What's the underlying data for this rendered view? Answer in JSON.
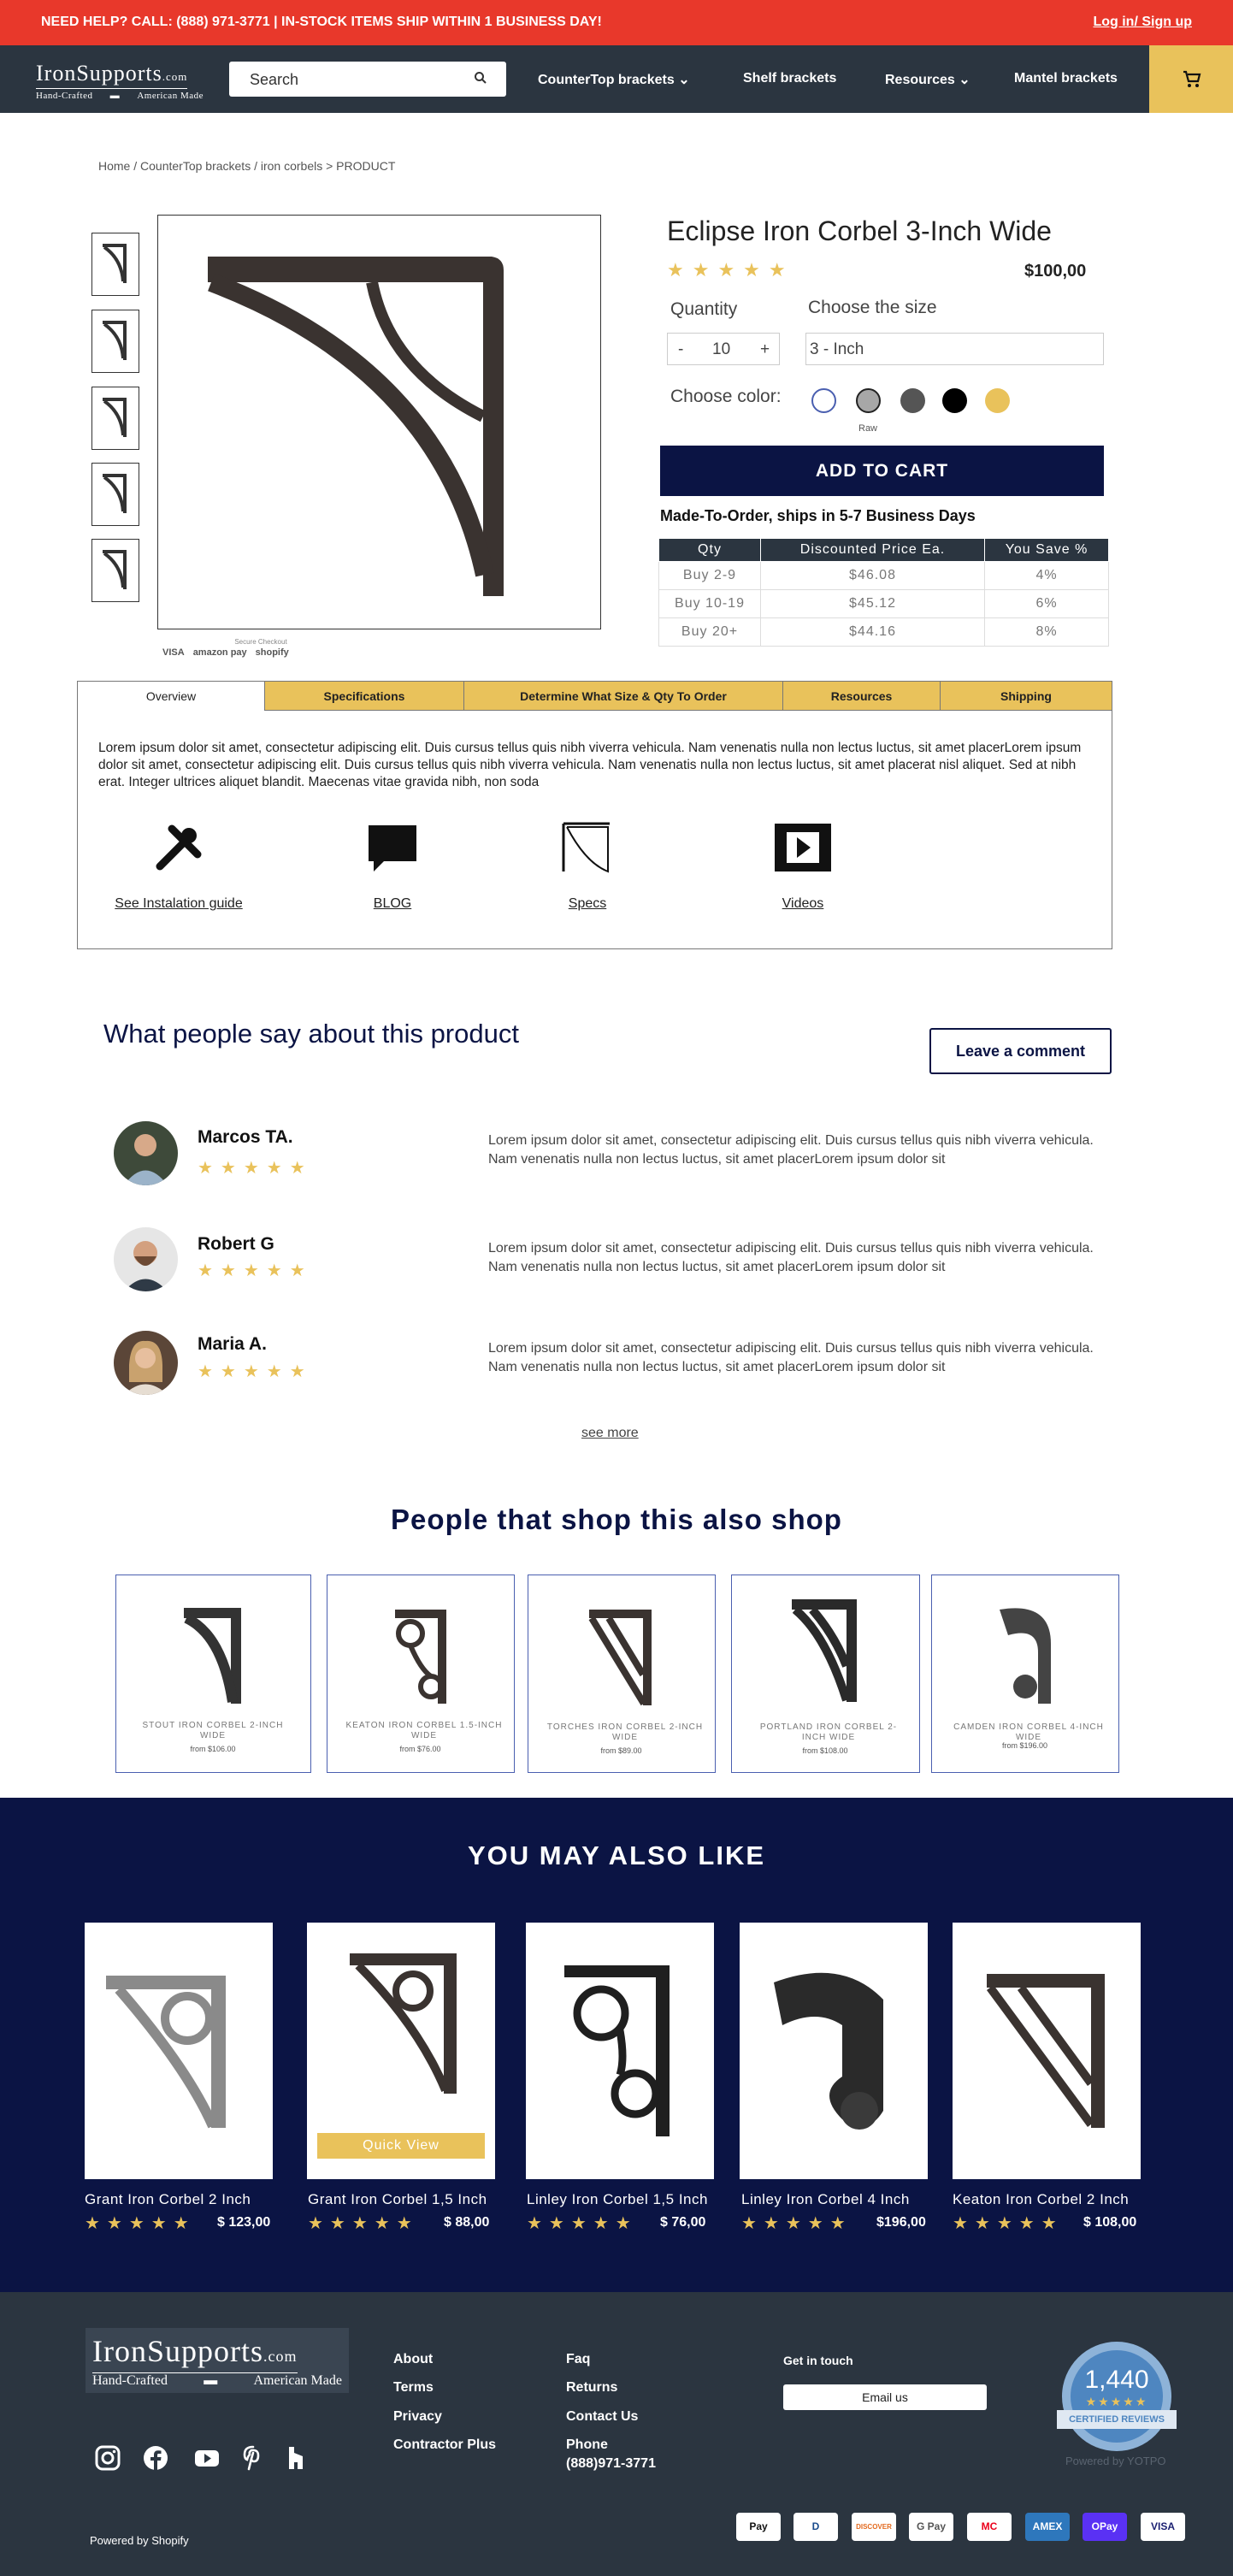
{
  "topbar": {
    "message": "NEED HELP? CALL: (888) 971-3771 | IN-STOCK ITEMS SHIP WITHIN 1 BUSINESS DAY!",
    "login": "Log in/ Sign up"
  },
  "header": {
    "logo_main": "IronSupports",
    "logo_suffix": ".com",
    "logo_left": "Hand-Crafted",
    "logo_right": "American Made",
    "search_placeholder": "Search",
    "nav": [
      "CounterTop brackets",
      "Shelf brackets",
      "Resources",
      "Mantel brackets"
    ]
  },
  "breadcrumb": "Home  /  CounterTop brackets  / iron corbels > PRODUCT",
  "product": {
    "title": "Eclipse Iron Corbel 3-Inch Wide",
    "stars": "★★★★★",
    "price": "$100,00",
    "quantity_label": "Quantity",
    "quantity_minus": "-",
    "quantity_value": "10",
    "quantity_plus": "+",
    "size_label": "Choose the size",
    "size_value": "3 - Inch",
    "color_label": "Choose color:",
    "color_selected_caption": "Raw",
    "colors": [
      "#ffffff",
      "#a7a7a7",
      "#555555",
      "#000000",
      "#e9c25b"
    ],
    "add_to_cart": "ADD TO CART",
    "made_to_order": "Made-To-Order, ships in 5-7 Business Days",
    "checkout_caption": "Secure Checkout",
    "checkout_logos": [
      "VISA",
      "amazon pay",
      "shopify"
    ]
  },
  "discount_table": {
    "headers": [
      "Qty",
      "Discounted Price Ea.",
      "You Save %"
    ],
    "rows": [
      [
        "Buy 2-9",
        "$46.08",
        "4%"
      ],
      [
        "Buy 10-19",
        "$45.12",
        "6%"
      ],
      [
        "Buy 20+",
        "$44.16",
        "8%"
      ]
    ]
  },
  "tabs": {
    "items": [
      "Overview",
      "Specifications",
      "Determine What Size & Qty To Order",
      "Resources",
      "Shipping"
    ],
    "overview_text": "Lorem ipsum dolor sit amet, consectetur adipiscing elit. Duis cursus tellus quis nibh viverra vehicula. Nam venenatis nulla non lectus luctus, sit amet placerLorem ipsum dolor sit amet, consectetur adipiscing elit. Duis cursus tellus quis nibh viverra vehicula. Nam venenatis nulla non lectus luctus, sit amet placerat nisl aliquet. Sed at nibh erat. Integer ultrices aliquet blandit. Maecenas vitae gravida nibh, non soda",
    "features": [
      "See Instalation guide",
      "BLOG",
      "Specs",
      "Videos"
    ]
  },
  "reviews": {
    "title": "What people say about this product",
    "leave_comment": "Leave a comment",
    "stars": "★★★★★",
    "items": [
      {
        "name": "Marcos TA.",
        "text": "Lorem ipsum dolor sit amet, consectetur adipiscing elit. Duis cursus tellus quis nibh viverra vehicula. Nam venenatis nulla non lectus luctus, sit amet placerLorem ipsum dolor sit"
      },
      {
        "name": "Robert G",
        "text": "Lorem ipsum dolor sit amet, consectetur adipiscing elit. Duis cursus tellus quis nibh viverra vehicula. Nam venenatis nulla non lectus luctus, sit amet placerLorem ipsum dolor sit"
      },
      {
        "name": "Maria A.",
        "text": "Lorem ipsum dolor sit amet, consectetur adipiscing elit. Duis cursus tellus quis nibh viverra vehicula. Nam venenatis nulla non lectus luctus, sit amet placerLorem ipsum dolor sit"
      }
    ],
    "see_more": "see more"
  },
  "also_shop": {
    "title": "People that shop this also shop",
    "items": [
      {
        "name": "STOUT IRON CORBEL 2-INCH WIDE",
        "price": "from $106.00"
      },
      {
        "name": "KEATON IRON CORBEL 1.5-INCH WIDE",
        "price": "from $76.00"
      },
      {
        "name": "TORCHES IRON CORBEL 2-INCH WIDE",
        "price": "from $89.00"
      },
      {
        "name": "PORTLAND IRON CORBEL 2-INCH WIDE",
        "price": "from $108.00"
      },
      {
        "name": "CAMDEN IRON CORBEL 4-INCH WIDE",
        "price": "from $196.00"
      }
    ]
  },
  "may_also_like": {
    "title": "YOU MAY ALSO LIKE",
    "quick_view": "Quick View",
    "stars": "★★★★★",
    "items": [
      {
        "name": "Grant Iron Corbel 2 Inch",
        "price": "$ 123,00"
      },
      {
        "name": "Grant Iron Corbel 1,5 Inch",
        "price": "$ 88,00"
      },
      {
        "name": "Linley Iron Corbel 1,5 Inch",
        "price": "$ 76,00"
      },
      {
        "name": "Linley Iron Corbel 4 Inch",
        "price": "$196,00"
      },
      {
        "name": "Keaton Iron Corbel 2 Inch",
        "price": "$ 108,00"
      }
    ]
  },
  "footer": {
    "col1": [
      "About",
      "Terms",
      "Privacy",
      "Contractor Plus"
    ],
    "col2": [
      "Faq",
      "Returns",
      "Contact Us",
      "Phone",
      "(888)971-3771"
    ],
    "get_in_touch": "Get in touch",
    "email_us": "Email us",
    "badge_count": "1,440",
    "badge_label": "CERTIFIED REVIEWS",
    "powered_yotpo": "Powered by YOTPO",
    "powered_shopify": "Powered by Shopify",
    "payments": [
      "Pay",
      "D",
      "DISCOVER",
      "G Pay",
      "MC",
      "AMEX",
      "OPay",
      "VISA"
    ]
  },
  "colors": {
    "red_bar": "#e8382b",
    "header": "#2b3540",
    "navy": "#0b1444",
    "gold": "#e9c25b"
  }
}
